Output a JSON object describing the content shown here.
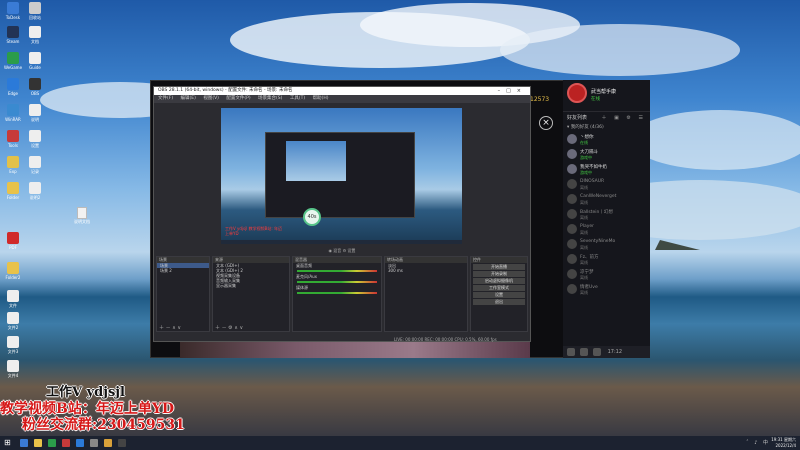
{
  "desktop": {
    "icons": [
      {
        "label": "ToDesk",
        "color": "#3a7bd5"
      },
      {
        "label": "回收站",
        "color": "#cccccc"
      },
      {
        "label": "Steam",
        "color": "#223355"
      },
      {
        "label": "文档",
        "color": "#eeeeee"
      },
      {
        "label": "WeGame",
        "color": "#2b9c4a"
      },
      {
        "label": "Guide",
        "color": "#eeeeee"
      },
      {
        "label": "Edge",
        "color": "#2b7ad9"
      },
      {
        "label": "OBS",
        "color": "#333333"
      },
      {
        "label": "WinRAR",
        "color": "#3a8ad0"
      },
      {
        "label": "说明",
        "color": "#eeeeee"
      },
      {
        "label": "Tools",
        "color": "#c63a3a"
      },
      {
        "label": "设置",
        "color": "#eeeeee"
      },
      {
        "label": "Exp",
        "color": "#e2c14a"
      },
      {
        "label": "记录",
        "color": "#eeeeee"
      },
      {
        "label": "Folder",
        "color": "#e8c24a"
      },
      {
        "label": "说明2",
        "color": "#eeeeee"
      },
      {
        "label": "PDF",
        "color": "#d02a2a"
      },
      {
        "label": "Folder2",
        "color": "#e8c24a"
      },
      {
        "label": "文件",
        "color": "#eeeeee"
      },
      {
        "label": "文件2",
        "color": "#eeeeee"
      },
      {
        "label": "文件3",
        "color": "#eeeeee"
      },
      {
        "label": "文件4",
        "color": "#eeeeee"
      }
    ],
    "stray_file": "说明文档"
  },
  "stream": {
    "top_count": "12573",
    "close_icon": "close-icon"
  },
  "obs": {
    "title": "OBS 28.1.1 (64-bit, windows) - 配置文件: 未命名 - 场景: 未命名",
    "menu": [
      "文件(F)",
      "编辑(E)",
      "视图(V)",
      "配置文件(P)",
      "场景集合(S)",
      "工具(T)",
      "帮助(H)"
    ],
    "zoom": "40s",
    "preview_red_text": "工作V ydjsjl 教学视频B站: 年迈上单YD",
    "ctrl_labels": "◉ 混音 ⚙ 设置",
    "scenes": {
      "header": "场景",
      "items": [
        "场景",
        "场景 2"
      ]
    },
    "sources": {
      "header": "来源",
      "items": [
        "文本 (GDI+)",
        "文本 (GDI+) 2",
        "视频采集设备",
        "音频输入采集",
        "显示器采集"
      ]
    },
    "mixer": {
      "header": "混音器",
      "channels": [
        "桌面音频",
        "麦克风/Aux",
        "媒体源"
      ]
    },
    "transitions": {
      "header": "转场动画",
      "type": "淡出",
      "duration": "300 ms"
    },
    "controls": {
      "header": "控件",
      "buttons": [
        "开始直播",
        "开始录制",
        "启动虚拟摄像机",
        "工作室模式",
        "设置",
        "退出"
      ]
    },
    "status": "LIVE: 00:00:00  REC: 00:00:00  CPU: 0.5%, 60.00 fps"
  },
  "side": {
    "username": "武当帮手康",
    "status": "在线",
    "tab": "好友列表",
    "tab_icons": "＋ ▣ ⚙ ☰",
    "group": "▾ 我的好友 (4/36)",
    "friends": [
      {
        "name": "丶想你",
        "status": "在线",
        "online": true
      },
      {
        "name": "大刀隔斗",
        "status": "游戏中",
        "online": true
      },
      {
        "name": "我哭不如牛奶",
        "status": "游戏中",
        "online": true
      },
      {
        "name": "DINOSAUR",
        "status": "离线",
        "online": false
      },
      {
        "name": "CanWeNeverget",
        "status": "离线",
        "online": false
      },
      {
        "name": "Ballstein丨幻想",
        "status": "离线",
        "online": false
      },
      {
        "name": "Player",
        "status": "离线",
        "online": false
      },
      {
        "name": "SeventyNineMo",
        "status": "离线",
        "online": false
      },
      {
        "name": "Fz、前方",
        "status": "离线",
        "online": false
      },
      {
        "name": "凉宁梦",
        "status": "离线",
        "online": false
      },
      {
        "name": "情者Uve",
        "status": "离线",
        "online": false
      }
    ],
    "bottom_time": "17:12"
  },
  "watermark": {
    "line1": "工作V ydjsjl",
    "line2": "教学视频B站：年迈上单YD",
    "line3": "粉丝交流群:230459531"
  },
  "taskbar": {
    "tray": "ˆ ♪ 中",
    "time": "19:31 星期六",
    "date": "2022/12/4",
    "apps": [
      {
        "color": "#3a7bd5"
      },
      {
        "color": "#e8c24a"
      },
      {
        "color": "#2b9c4a"
      },
      {
        "color": "#c63a3a"
      },
      {
        "color": "#2b7ad9"
      },
      {
        "color": "#888888"
      },
      {
        "color": "#d9a13a"
      },
      {
        "color": "#444444"
      }
    ]
  }
}
